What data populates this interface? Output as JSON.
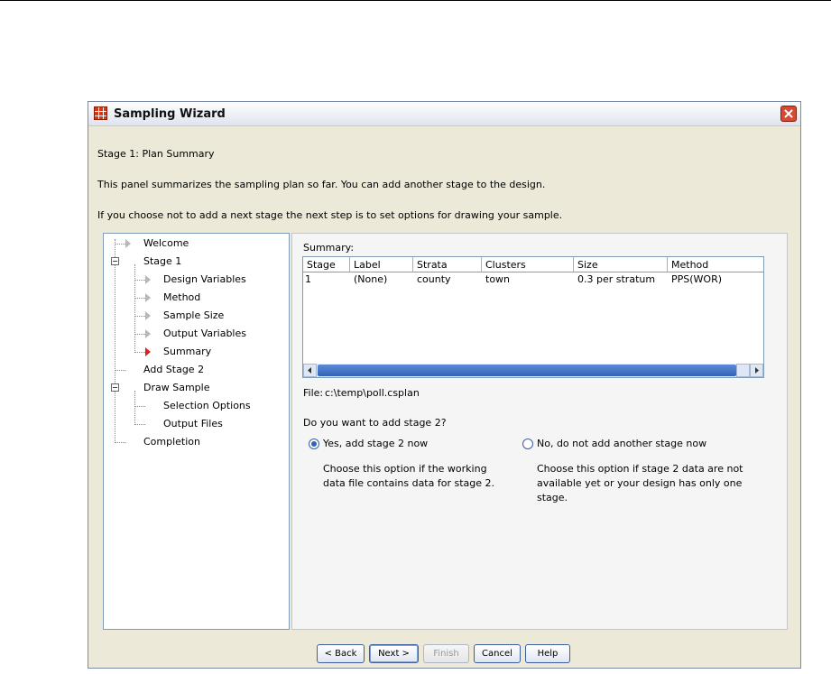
{
  "window": {
    "title": "Sampling Wizard"
  },
  "panel": {
    "heading": "Stage 1: Plan Summary",
    "line1": "This panel summarizes the sampling plan so far. You can add another stage to the design.",
    "line2": "If you choose not to add a next stage the next step is to set options for drawing your sample."
  },
  "tree": {
    "items": [
      {
        "label": "Welcome"
      },
      {
        "label": "Stage 1"
      },
      {
        "label": "Design Variables"
      },
      {
        "label": "Method"
      },
      {
        "label": "Sample Size"
      },
      {
        "label": "Output Variables"
      },
      {
        "label": "Summary"
      },
      {
        "label": "Add Stage 2"
      },
      {
        "label": "Draw Sample"
      },
      {
        "label": "Selection Options"
      },
      {
        "label": "Output Files"
      },
      {
        "label": "Completion"
      }
    ]
  },
  "summary": {
    "label": "Summary:",
    "columns": [
      "Stage",
      "Label",
      "Strata",
      "Clusters",
      "Size",
      "Method"
    ],
    "rows": [
      [
        "1",
        "(None)",
        "county",
        "town",
        "0.3 per stratum",
        "PPS(WOR)"
      ]
    ]
  },
  "file": {
    "label": "File:",
    "path": "c:\\temp\\poll.csplan"
  },
  "question": "Do you want to add stage 2?",
  "options": {
    "yes": {
      "label": "Yes, add stage 2 now",
      "description": "Choose this option if the working data file contains data for stage 2.",
      "selected": true
    },
    "no": {
      "label": "No, do not add another stage now",
      "description": "Choose this option if stage 2 data are not available yet or your design has only one stage.",
      "selected": false
    }
  },
  "buttons": {
    "back": "< Back",
    "next": "Next >",
    "finish": "Finish",
    "cancel": "Cancel",
    "help": "Help"
  },
  "colors": {
    "active_marker": "#e02020",
    "dialog_bg": "#ece9d8",
    "scroll_thumb": "#2f62b8"
  }
}
